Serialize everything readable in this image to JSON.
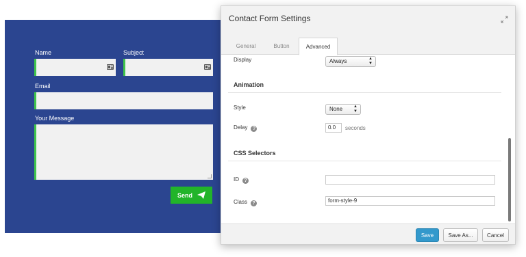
{
  "contact_form": {
    "name_label": "Name",
    "subject_label": "Subject",
    "email_label": "Email",
    "message_label": "Your Message",
    "send_label": "Send",
    "colors": {
      "panel": "#2b4590",
      "accent": "#3ec44b",
      "send": "#22b42a"
    }
  },
  "dialog": {
    "title": "Contact Form Settings",
    "tabs": [
      {
        "label": "General",
        "active": false
      },
      {
        "label": "Button",
        "active": false
      },
      {
        "label": "Advanced",
        "active": true
      }
    ],
    "display": {
      "label": "Display",
      "value": "Always"
    },
    "animation": {
      "heading": "Animation",
      "style_label": "Style",
      "style_value": "None",
      "delay_label": "Delay",
      "delay_value": "0.0",
      "delay_unit": "seconds"
    },
    "css": {
      "heading": "CSS Selectors",
      "id_label": "ID",
      "id_value": "",
      "class_label": "Class",
      "class_value": "form-style-9"
    },
    "footer": {
      "save": "Save",
      "save_as": "Save As...",
      "cancel": "Cancel"
    },
    "icons": {
      "expand": "expand-icon",
      "help": "help-icon",
      "send": "paper-plane-icon",
      "card": "contact-card-icon"
    },
    "colors": {
      "primary": "#3399cc"
    }
  }
}
